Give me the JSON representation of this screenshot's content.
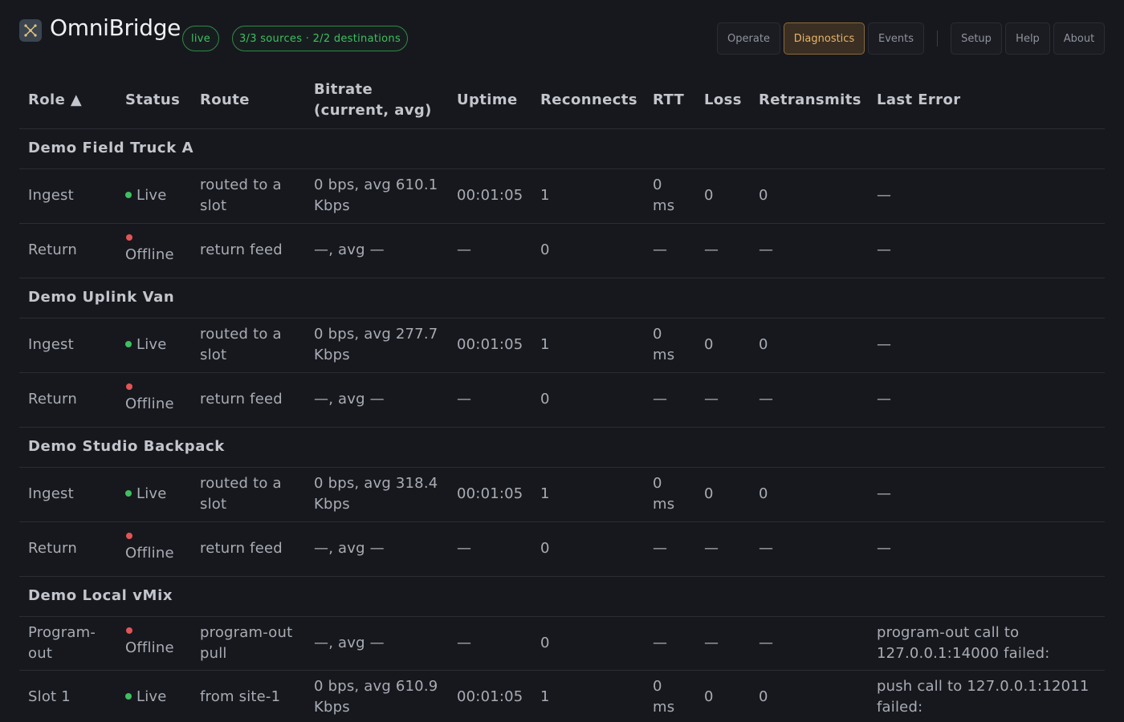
{
  "header": {
    "app_title": "OmniBridge",
    "live_pill": "live",
    "counts_pill": "3/3 sources · 2/2 destinations",
    "nav": [
      {
        "label": "Operate",
        "active": false
      },
      {
        "label": "Diagnostics",
        "active": true
      },
      {
        "label": "Events",
        "active": false
      },
      {
        "label": "Setup",
        "active": false
      },
      {
        "label": "Help",
        "active": false
      },
      {
        "label": "About",
        "active": false
      }
    ]
  },
  "table": {
    "columns": [
      "Role ▲",
      "Status",
      "Route",
      "Bitrate (current, avg)",
      "Uptime",
      "Reconnects",
      "RTT",
      "Loss",
      "Retransmits",
      "Last Error"
    ],
    "groups": [
      {
        "name": "Demo Field Truck A",
        "rows": [
          {
            "role": "Ingest",
            "status": "Live",
            "route": "routed to a slot",
            "bitrate": "0 bps, avg 610.1 Kbps",
            "uptime": "00:01:05",
            "reconnects": "1",
            "rtt": "0 ms",
            "loss": "0",
            "retransmits": "0",
            "last_error": "—"
          },
          {
            "role": "Return",
            "status": "Offline",
            "route": "return feed",
            "bitrate": "—, avg —",
            "uptime": "—",
            "reconnects": "0",
            "rtt": "—",
            "loss": "—",
            "retransmits": "—",
            "last_error": "—"
          }
        ]
      },
      {
        "name": "Demo Uplink Van",
        "rows": [
          {
            "role": "Ingest",
            "status": "Live",
            "route": "routed to a slot",
            "bitrate": "0 bps, avg 277.7 Kbps",
            "uptime": "00:01:05",
            "reconnects": "1",
            "rtt": "0 ms",
            "loss": "0",
            "retransmits": "0",
            "last_error": "—"
          },
          {
            "role": "Return",
            "status": "Offline",
            "route": "return feed",
            "bitrate": "—, avg —",
            "uptime": "—",
            "reconnects": "0",
            "rtt": "—",
            "loss": "—",
            "retransmits": "—",
            "last_error": "—"
          }
        ]
      },
      {
        "name": "Demo Studio Backpack",
        "rows": [
          {
            "role": "Ingest",
            "status": "Live",
            "route": "routed to a slot",
            "bitrate": "0 bps, avg 318.4 Kbps",
            "uptime": "00:01:05",
            "reconnects": "1",
            "rtt": "0 ms",
            "loss": "0",
            "retransmits": "0",
            "last_error": "—"
          },
          {
            "role": "Return",
            "status": "Offline",
            "route": "return feed",
            "bitrate": "—, avg —",
            "uptime": "—",
            "reconnects": "0",
            "rtt": "—",
            "loss": "—",
            "retransmits": "—",
            "last_error": "—"
          }
        ]
      },
      {
        "name": "Demo Local vMix",
        "rows": [
          {
            "role": "Program-out",
            "status": "Offline",
            "route": "program-out pull",
            "bitrate": "—, avg —",
            "uptime": "—",
            "reconnects": "0",
            "rtt": "—",
            "loss": "—",
            "retransmits": "—",
            "last_error": "program-out call to 127.0.0.1:14000 failed:"
          },
          {
            "role": "Slot 1",
            "status": "Live",
            "route": "from site-1",
            "bitrate": "0 bps, avg 610.9 Kbps",
            "uptime": "00:01:05",
            "reconnects": "1",
            "rtt": "0 ms",
            "loss": "0",
            "retransmits": "0",
            "last_error": "push call to 127.0.0.1:12011 failed:"
          }
        ]
      }
    ]
  },
  "colors": {
    "background": "#17181d",
    "live": "#3fbf60",
    "offline": "#e05555",
    "active_tab": "#e8b46a"
  },
  "icons": {
    "logo": "omnibridge-logo-icon"
  }
}
